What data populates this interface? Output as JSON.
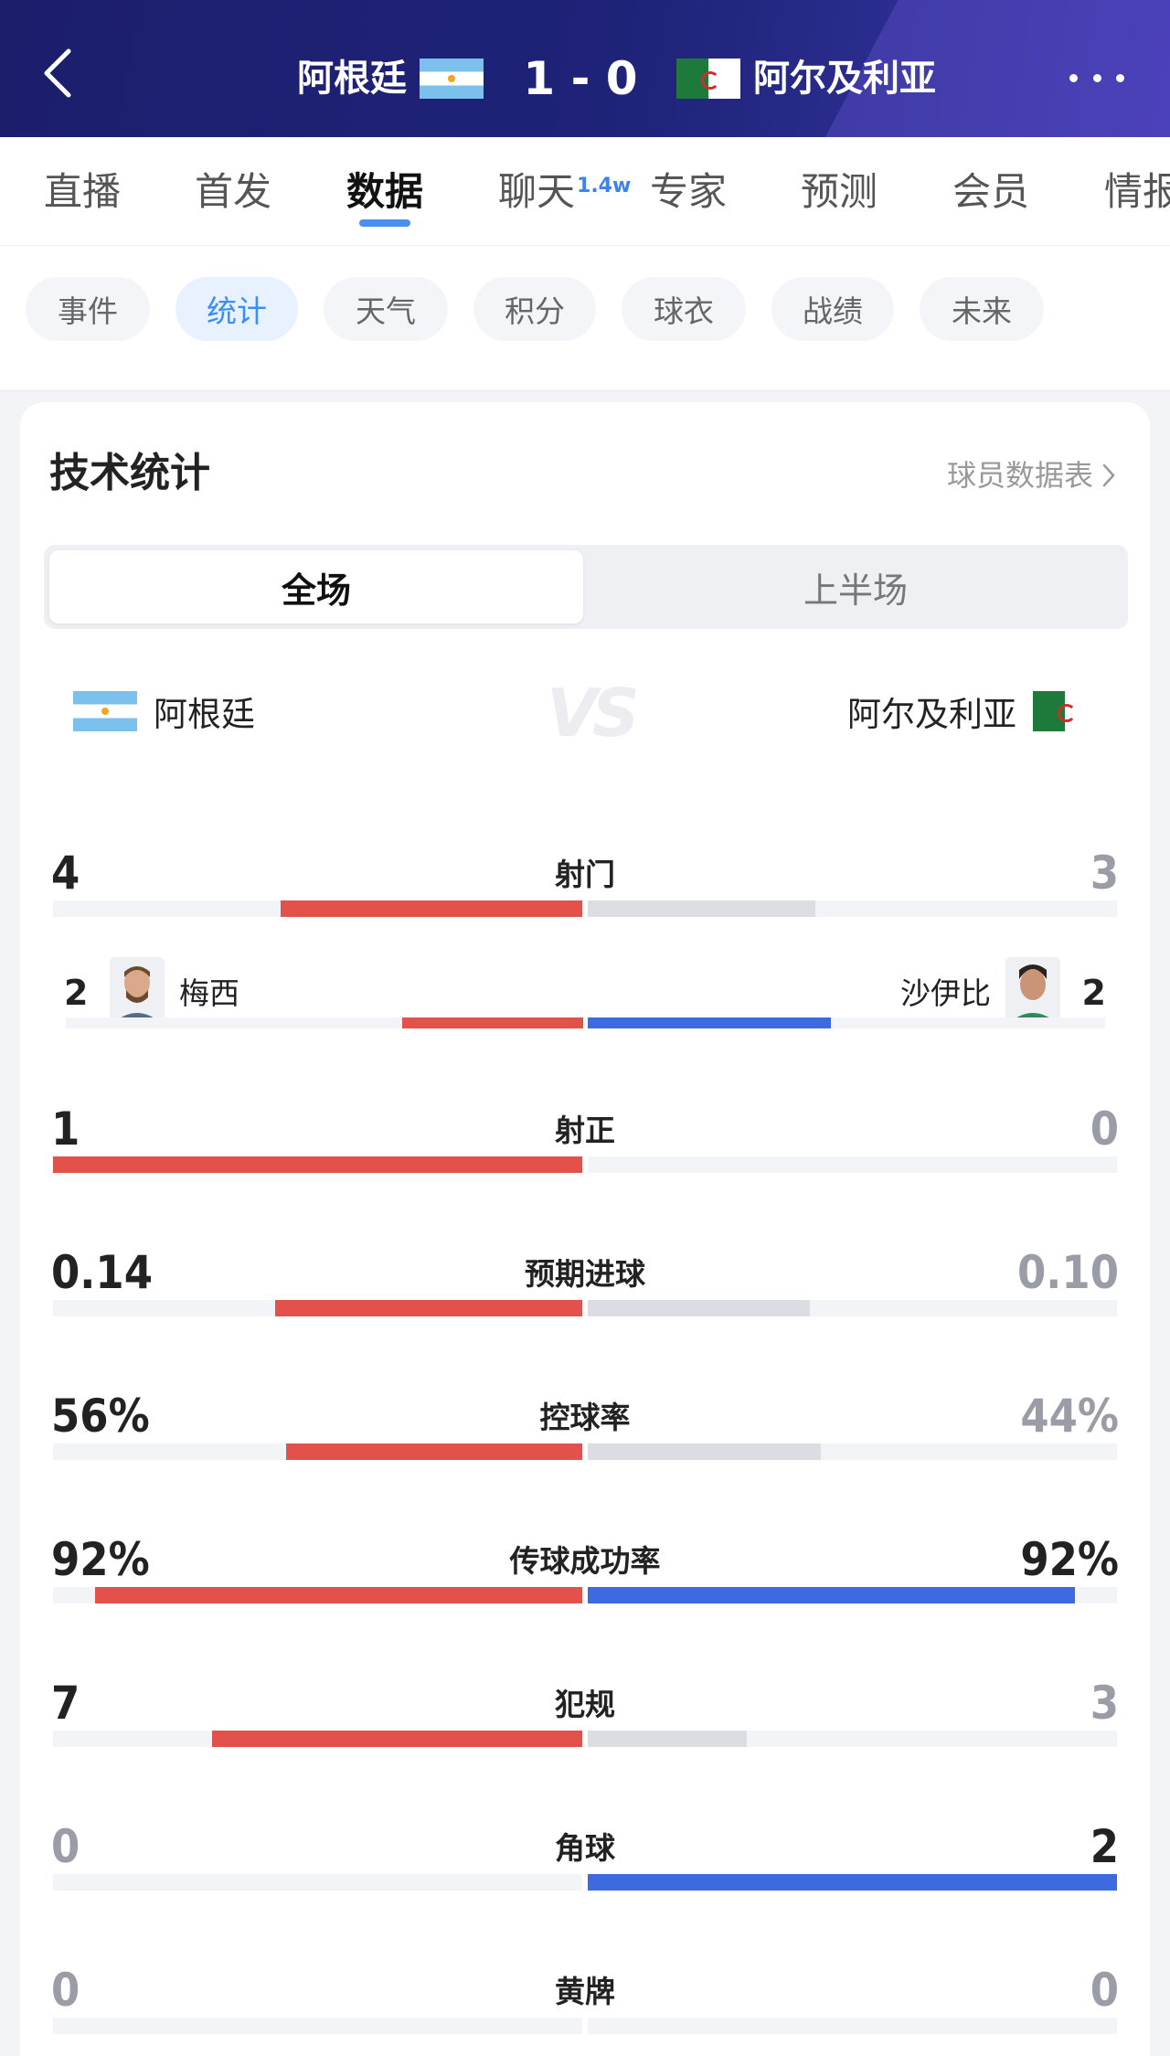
{
  "header": {
    "back_icon": "chevron-left-icon",
    "home_team": "阿根廷",
    "away_team": "阿尔及利亚",
    "score": "1 - 0",
    "more_icon": "more-horizontal-icon"
  },
  "tabs": [
    {
      "label": "直播",
      "active": false
    },
    {
      "label": "首发",
      "active": false
    },
    {
      "label": "数据",
      "active": true
    },
    {
      "label": "聊天",
      "badge": "1.4w",
      "active": false
    },
    {
      "label": "专家",
      "active": false
    },
    {
      "label": "预测",
      "active": false
    },
    {
      "label": "会员",
      "active": false
    },
    {
      "label": "情报",
      "active": false
    }
  ],
  "subtabs": [
    {
      "label": "事件",
      "active": false
    },
    {
      "label": "统计",
      "active": true
    },
    {
      "label": "天气",
      "active": false
    },
    {
      "label": "积分",
      "active": false
    },
    {
      "label": "球衣",
      "active": false
    },
    {
      "label": "战绩",
      "active": false
    },
    {
      "label": "未来",
      "active": false
    }
  ],
  "card": {
    "title": "技术统计",
    "player_link": "球员数据表",
    "segments": [
      "全场",
      "上半场"
    ],
    "active_segment": "全场",
    "home_team": "阿根廷",
    "away_team": "阿尔及利亚"
  },
  "colors": {
    "home_bar": "#e3524a",
    "away_bar_strong": "#3d6ae0",
    "away_bar_weak": "#dcdde2",
    "value_strong": "#222222",
    "value_weak": "#9a9ca6",
    "accent": "#3a8ff5"
  },
  "stats": [
    {
      "label": "射门",
      "home": "4",
      "away": "3",
      "home_frac": 0.57,
      "away_frac": 0.43
    },
    {
      "label": "射正",
      "home": "1",
      "away": "0",
      "home_frac": 1.0,
      "away_frac": 0.0
    },
    {
      "label": "预期进球",
      "home": "0.14",
      "away": "0.10",
      "home_frac": 0.58,
      "away_frac": 0.42
    },
    {
      "label": "控球率",
      "home": "56%",
      "away": "44%",
      "home_frac": 0.56,
      "away_frac": 0.44
    },
    {
      "label": "传球成功率",
      "home": "92%",
      "away": "92%",
      "home_frac": 0.92,
      "away_frac": 0.92
    },
    {
      "label": "犯规",
      "home": "7",
      "away": "3",
      "home_frac": 0.7,
      "away_frac": 0.3
    },
    {
      "label": "角球",
      "home": "0",
      "away": "2",
      "home_frac": 0.0,
      "away_frac": 1.0
    },
    {
      "label": "黄牌",
      "home": "0",
      "away": "0",
      "home_frac": 0.0,
      "away_frac": 0.0
    }
  ],
  "top_shooters": {
    "home": {
      "name": "梅西",
      "count": "2",
      "frac": 0.35
    },
    "away": {
      "name": "沙伊比",
      "count": "2",
      "frac": 0.47
    }
  }
}
